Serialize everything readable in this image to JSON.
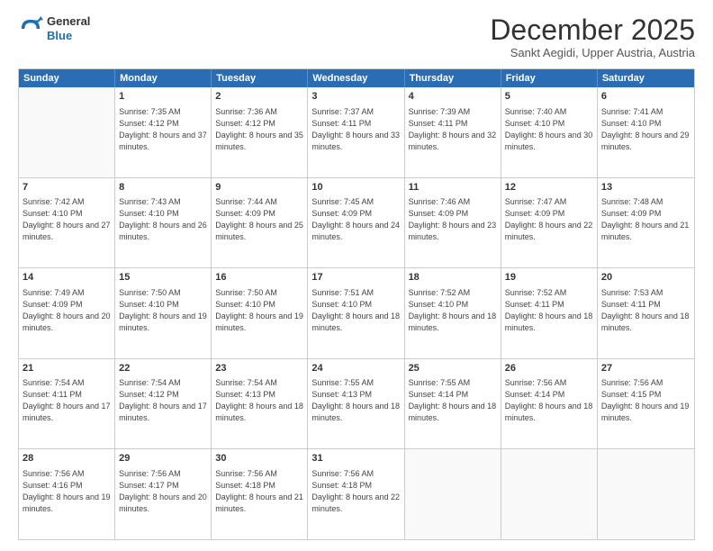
{
  "logo": {
    "line1": "General",
    "line2": "Blue"
  },
  "title": "December 2025",
  "subtitle": "Sankt Aegidi, Upper Austria, Austria",
  "header_days": [
    "Sunday",
    "Monday",
    "Tuesday",
    "Wednesday",
    "Thursday",
    "Friday",
    "Saturday"
  ],
  "weeks": [
    [
      {
        "day": "",
        "sunrise": "",
        "sunset": "",
        "daylight": ""
      },
      {
        "day": "1",
        "sunrise": "Sunrise: 7:35 AM",
        "sunset": "Sunset: 4:12 PM",
        "daylight": "Daylight: 8 hours and 37 minutes."
      },
      {
        "day": "2",
        "sunrise": "Sunrise: 7:36 AM",
        "sunset": "Sunset: 4:12 PM",
        "daylight": "Daylight: 8 hours and 35 minutes."
      },
      {
        "day": "3",
        "sunrise": "Sunrise: 7:37 AM",
        "sunset": "Sunset: 4:11 PM",
        "daylight": "Daylight: 8 hours and 33 minutes."
      },
      {
        "day": "4",
        "sunrise": "Sunrise: 7:39 AM",
        "sunset": "Sunset: 4:11 PM",
        "daylight": "Daylight: 8 hours and 32 minutes."
      },
      {
        "day": "5",
        "sunrise": "Sunrise: 7:40 AM",
        "sunset": "Sunset: 4:10 PM",
        "daylight": "Daylight: 8 hours and 30 minutes."
      },
      {
        "day": "6",
        "sunrise": "Sunrise: 7:41 AM",
        "sunset": "Sunset: 4:10 PM",
        "daylight": "Daylight: 8 hours and 29 minutes."
      }
    ],
    [
      {
        "day": "7",
        "sunrise": "Sunrise: 7:42 AM",
        "sunset": "Sunset: 4:10 PM",
        "daylight": "Daylight: 8 hours and 27 minutes."
      },
      {
        "day": "8",
        "sunrise": "Sunrise: 7:43 AM",
        "sunset": "Sunset: 4:10 PM",
        "daylight": "Daylight: 8 hours and 26 minutes."
      },
      {
        "day": "9",
        "sunrise": "Sunrise: 7:44 AM",
        "sunset": "Sunset: 4:09 PM",
        "daylight": "Daylight: 8 hours and 25 minutes."
      },
      {
        "day": "10",
        "sunrise": "Sunrise: 7:45 AM",
        "sunset": "Sunset: 4:09 PM",
        "daylight": "Daylight: 8 hours and 24 minutes."
      },
      {
        "day": "11",
        "sunrise": "Sunrise: 7:46 AM",
        "sunset": "Sunset: 4:09 PM",
        "daylight": "Daylight: 8 hours and 23 minutes."
      },
      {
        "day": "12",
        "sunrise": "Sunrise: 7:47 AM",
        "sunset": "Sunset: 4:09 PM",
        "daylight": "Daylight: 8 hours and 22 minutes."
      },
      {
        "day": "13",
        "sunrise": "Sunrise: 7:48 AM",
        "sunset": "Sunset: 4:09 PM",
        "daylight": "Daylight: 8 hours and 21 minutes."
      }
    ],
    [
      {
        "day": "14",
        "sunrise": "Sunrise: 7:49 AM",
        "sunset": "Sunset: 4:09 PM",
        "daylight": "Daylight: 8 hours and 20 minutes."
      },
      {
        "day": "15",
        "sunrise": "Sunrise: 7:50 AM",
        "sunset": "Sunset: 4:10 PM",
        "daylight": "Daylight: 8 hours and 19 minutes."
      },
      {
        "day": "16",
        "sunrise": "Sunrise: 7:50 AM",
        "sunset": "Sunset: 4:10 PM",
        "daylight": "Daylight: 8 hours and 19 minutes."
      },
      {
        "day": "17",
        "sunrise": "Sunrise: 7:51 AM",
        "sunset": "Sunset: 4:10 PM",
        "daylight": "Daylight: 8 hours and 18 minutes."
      },
      {
        "day": "18",
        "sunrise": "Sunrise: 7:52 AM",
        "sunset": "Sunset: 4:10 PM",
        "daylight": "Daylight: 8 hours and 18 minutes."
      },
      {
        "day": "19",
        "sunrise": "Sunrise: 7:52 AM",
        "sunset": "Sunset: 4:11 PM",
        "daylight": "Daylight: 8 hours and 18 minutes."
      },
      {
        "day": "20",
        "sunrise": "Sunrise: 7:53 AM",
        "sunset": "Sunset: 4:11 PM",
        "daylight": "Daylight: 8 hours and 18 minutes."
      }
    ],
    [
      {
        "day": "21",
        "sunrise": "Sunrise: 7:54 AM",
        "sunset": "Sunset: 4:11 PM",
        "daylight": "Daylight: 8 hours and 17 minutes."
      },
      {
        "day": "22",
        "sunrise": "Sunrise: 7:54 AM",
        "sunset": "Sunset: 4:12 PM",
        "daylight": "Daylight: 8 hours and 17 minutes."
      },
      {
        "day": "23",
        "sunrise": "Sunrise: 7:54 AM",
        "sunset": "Sunset: 4:13 PM",
        "daylight": "Daylight: 8 hours and 18 minutes."
      },
      {
        "day": "24",
        "sunrise": "Sunrise: 7:55 AM",
        "sunset": "Sunset: 4:13 PM",
        "daylight": "Daylight: 8 hours and 18 minutes."
      },
      {
        "day": "25",
        "sunrise": "Sunrise: 7:55 AM",
        "sunset": "Sunset: 4:14 PM",
        "daylight": "Daylight: 8 hours and 18 minutes."
      },
      {
        "day": "26",
        "sunrise": "Sunrise: 7:56 AM",
        "sunset": "Sunset: 4:14 PM",
        "daylight": "Daylight: 8 hours and 18 minutes."
      },
      {
        "day": "27",
        "sunrise": "Sunrise: 7:56 AM",
        "sunset": "Sunset: 4:15 PM",
        "daylight": "Daylight: 8 hours and 19 minutes."
      }
    ],
    [
      {
        "day": "28",
        "sunrise": "Sunrise: 7:56 AM",
        "sunset": "Sunset: 4:16 PM",
        "daylight": "Daylight: 8 hours and 19 minutes."
      },
      {
        "day": "29",
        "sunrise": "Sunrise: 7:56 AM",
        "sunset": "Sunset: 4:17 PM",
        "daylight": "Daylight: 8 hours and 20 minutes."
      },
      {
        "day": "30",
        "sunrise": "Sunrise: 7:56 AM",
        "sunset": "Sunset: 4:18 PM",
        "daylight": "Daylight: 8 hours and 21 minutes."
      },
      {
        "day": "31",
        "sunrise": "Sunrise: 7:56 AM",
        "sunset": "Sunset: 4:18 PM",
        "daylight": "Daylight: 8 hours and 22 minutes."
      },
      {
        "day": "",
        "sunrise": "",
        "sunset": "",
        "daylight": ""
      },
      {
        "day": "",
        "sunrise": "",
        "sunset": "",
        "daylight": ""
      },
      {
        "day": "",
        "sunrise": "",
        "sunset": "",
        "daylight": ""
      }
    ]
  ]
}
